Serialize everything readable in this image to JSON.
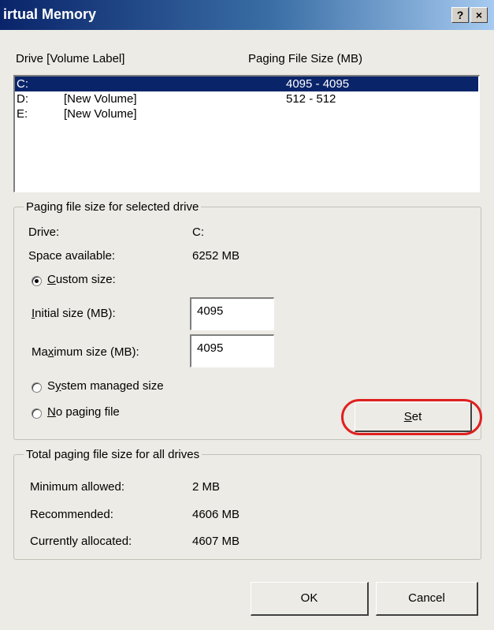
{
  "window": {
    "title": "irtual Memory",
    "help_button": "?",
    "close_button": "×"
  },
  "list": {
    "header_drive": "Drive  [Volume Label]",
    "header_size": "Paging File Size (MB)",
    "rows": [
      {
        "drive": "C:",
        "label": "",
        "size": "4095 - 4095",
        "selected": true
      },
      {
        "drive": "D:",
        "label": "[New Volume]",
        "size": "512 - 512",
        "selected": false
      },
      {
        "drive": "E:",
        "label": "[New Volume]",
        "size": "",
        "selected": false
      }
    ]
  },
  "selected_drive": {
    "legend": "Paging file size for selected drive",
    "drive_label": "Drive:",
    "drive_value": "C:",
    "space_label": "Space available:",
    "space_value": "6252 MB",
    "custom_size": {
      "pre": "",
      "key": "C",
      "post": "ustom size:",
      "checked": true
    },
    "initial": {
      "pre": "",
      "key": "I",
      "post": "nitial size (MB):",
      "value": "4095"
    },
    "maximum": {
      "pre": "Ma",
      "key": "x",
      "post": "imum size (MB):",
      "value": "4095"
    },
    "system_managed": {
      "pre": "S",
      "key": "y",
      "post": "stem managed size",
      "checked": false
    },
    "no_paging": {
      "pre": "",
      "key": "N",
      "post": "o paging file",
      "checked": false
    },
    "set_button": {
      "pre": "",
      "key": "S",
      "post": "et"
    }
  },
  "totals": {
    "legend": "Total paging file size for all drives",
    "min_label": "Minimum allowed:",
    "min_value": "2 MB",
    "rec_label": "Recommended:",
    "rec_value": "4606 MB",
    "cur_label": "Currently allocated:",
    "cur_value": "4607 MB"
  },
  "buttons": {
    "ok": "OK",
    "cancel": "Cancel"
  },
  "colors": {
    "selection": "#0a246a",
    "highlight_ring": "#e02020",
    "dialog_bg": "#ecebe5"
  }
}
